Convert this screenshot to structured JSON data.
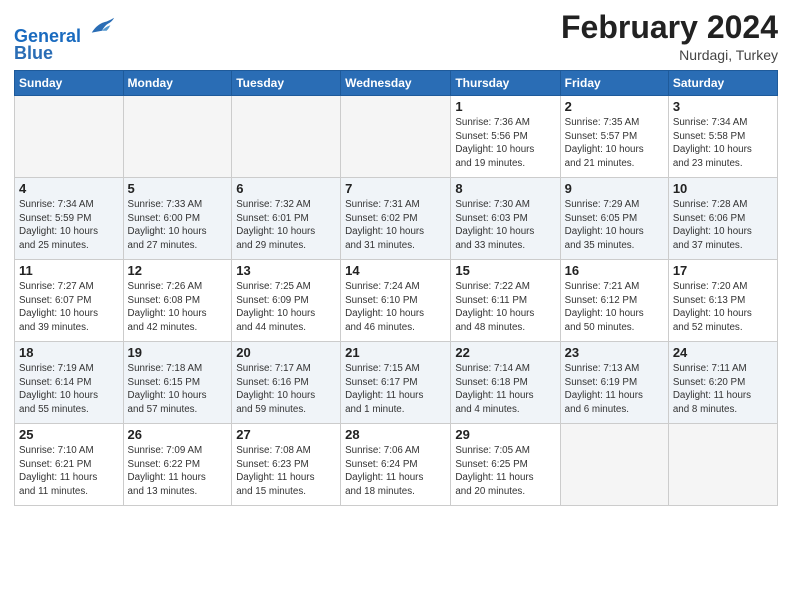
{
  "header": {
    "logo_line1": "General",
    "logo_line2": "Blue",
    "title": "February 2024",
    "subtitle": "Nurdagi, Turkey"
  },
  "days_of_week": [
    "Sunday",
    "Monday",
    "Tuesday",
    "Wednesday",
    "Thursday",
    "Friday",
    "Saturday"
  ],
  "weeks": [
    [
      {
        "day": "",
        "info": ""
      },
      {
        "day": "",
        "info": ""
      },
      {
        "day": "",
        "info": ""
      },
      {
        "day": "",
        "info": ""
      },
      {
        "day": "1",
        "info": "Sunrise: 7:36 AM\nSunset: 5:56 PM\nDaylight: 10 hours\nand 19 minutes."
      },
      {
        "day": "2",
        "info": "Sunrise: 7:35 AM\nSunset: 5:57 PM\nDaylight: 10 hours\nand 21 minutes."
      },
      {
        "day": "3",
        "info": "Sunrise: 7:34 AM\nSunset: 5:58 PM\nDaylight: 10 hours\nand 23 minutes."
      }
    ],
    [
      {
        "day": "4",
        "info": "Sunrise: 7:34 AM\nSunset: 5:59 PM\nDaylight: 10 hours\nand 25 minutes."
      },
      {
        "day": "5",
        "info": "Sunrise: 7:33 AM\nSunset: 6:00 PM\nDaylight: 10 hours\nand 27 minutes."
      },
      {
        "day": "6",
        "info": "Sunrise: 7:32 AM\nSunset: 6:01 PM\nDaylight: 10 hours\nand 29 minutes."
      },
      {
        "day": "7",
        "info": "Sunrise: 7:31 AM\nSunset: 6:02 PM\nDaylight: 10 hours\nand 31 minutes."
      },
      {
        "day": "8",
        "info": "Sunrise: 7:30 AM\nSunset: 6:03 PM\nDaylight: 10 hours\nand 33 minutes."
      },
      {
        "day": "9",
        "info": "Sunrise: 7:29 AM\nSunset: 6:05 PM\nDaylight: 10 hours\nand 35 minutes."
      },
      {
        "day": "10",
        "info": "Sunrise: 7:28 AM\nSunset: 6:06 PM\nDaylight: 10 hours\nand 37 minutes."
      }
    ],
    [
      {
        "day": "11",
        "info": "Sunrise: 7:27 AM\nSunset: 6:07 PM\nDaylight: 10 hours\nand 39 minutes."
      },
      {
        "day": "12",
        "info": "Sunrise: 7:26 AM\nSunset: 6:08 PM\nDaylight: 10 hours\nand 42 minutes."
      },
      {
        "day": "13",
        "info": "Sunrise: 7:25 AM\nSunset: 6:09 PM\nDaylight: 10 hours\nand 44 minutes."
      },
      {
        "day": "14",
        "info": "Sunrise: 7:24 AM\nSunset: 6:10 PM\nDaylight: 10 hours\nand 46 minutes."
      },
      {
        "day": "15",
        "info": "Sunrise: 7:22 AM\nSunset: 6:11 PM\nDaylight: 10 hours\nand 48 minutes."
      },
      {
        "day": "16",
        "info": "Sunrise: 7:21 AM\nSunset: 6:12 PM\nDaylight: 10 hours\nand 50 minutes."
      },
      {
        "day": "17",
        "info": "Sunrise: 7:20 AM\nSunset: 6:13 PM\nDaylight: 10 hours\nand 52 minutes."
      }
    ],
    [
      {
        "day": "18",
        "info": "Sunrise: 7:19 AM\nSunset: 6:14 PM\nDaylight: 10 hours\nand 55 minutes."
      },
      {
        "day": "19",
        "info": "Sunrise: 7:18 AM\nSunset: 6:15 PM\nDaylight: 10 hours\nand 57 minutes."
      },
      {
        "day": "20",
        "info": "Sunrise: 7:17 AM\nSunset: 6:16 PM\nDaylight: 10 hours\nand 59 minutes."
      },
      {
        "day": "21",
        "info": "Sunrise: 7:15 AM\nSunset: 6:17 PM\nDaylight: 11 hours\nand 1 minute."
      },
      {
        "day": "22",
        "info": "Sunrise: 7:14 AM\nSunset: 6:18 PM\nDaylight: 11 hours\nand 4 minutes."
      },
      {
        "day": "23",
        "info": "Sunrise: 7:13 AM\nSunset: 6:19 PM\nDaylight: 11 hours\nand 6 minutes."
      },
      {
        "day": "24",
        "info": "Sunrise: 7:11 AM\nSunset: 6:20 PM\nDaylight: 11 hours\nand 8 minutes."
      }
    ],
    [
      {
        "day": "25",
        "info": "Sunrise: 7:10 AM\nSunset: 6:21 PM\nDaylight: 11 hours\nand 11 minutes."
      },
      {
        "day": "26",
        "info": "Sunrise: 7:09 AM\nSunset: 6:22 PM\nDaylight: 11 hours\nand 13 minutes."
      },
      {
        "day": "27",
        "info": "Sunrise: 7:08 AM\nSunset: 6:23 PM\nDaylight: 11 hours\nand 15 minutes."
      },
      {
        "day": "28",
        "info": "Sunrise: 7:06 AM\nSunset: 6:24 PM\nDaylight: 11 hours\nand 18 minutes."
      },
      {
        "day": "29",
        "info": "Sunrise: 7:05 AM\nSunset: 6:25 PM\nDaylight: 11 hours\nand 20 minutes."
      },
      {
        "day": "",
        "info": ""
      },
      {
        "day": "",
        "info": ""
      }
    ]
  ]
}
